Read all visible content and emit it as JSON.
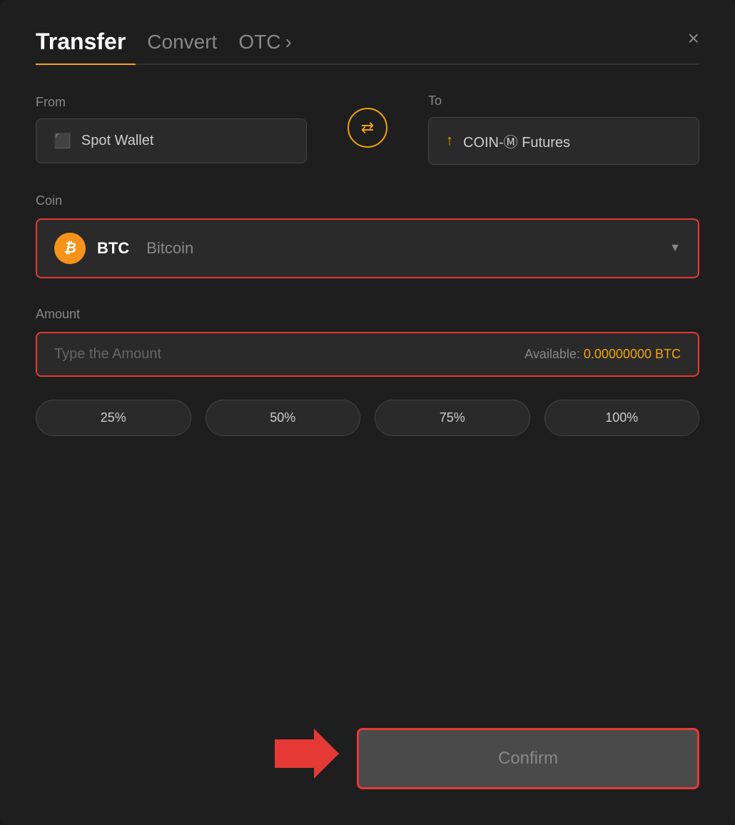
{
  "header": {
    "tab_transfer": "Transfer",
    "tab_convert": "Convert",
    "tab_otc": "OTC",
    "close_label": "×"
  },
  "from_section": {
    "label": "From",
    "wallet_name": "Spot Wallet",
    "wallet_icon": "💳"
  },
  "to_section": {
    "label": "To",
    "wallet_name": "COIN-Ⓜ Futures",
    "wallet_icon": "↑"
  },
  "swap_button": {
    "icon": "⇄"
  },
  "coin_section": {
    "label": "Coin",
    "coin_symbol": "BTC",
    "coin_name": "Bitcoin",
    "chevron": "▼"
  },
  "amount_section": {
    "label": "Amount",
    "placeholder": "Type the Amount",
    "available_label": "Available:",
    "available_amount": "0.00000000 BTC"
  },
  "percent_buttons": [
    {
      "label": "25%"
    },
    {
      "label": "50%"
    },
    {
      "label": "75%"
    },
    {
      "label": "100%"
    }
  ],
  "confirm_button": {
    "label": "Confirm"
  }
}
